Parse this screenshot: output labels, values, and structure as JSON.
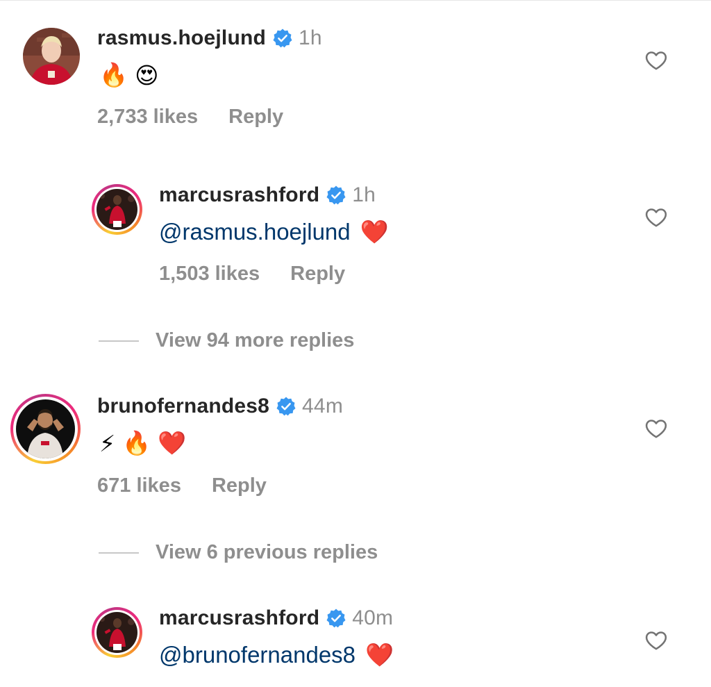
{
  "comments": [
    {
      "username": "rasmus.hoejlund",
      "time": "1h",
      "emojis": [
        "🔥",
        "😍"
      ],
      "likes": "2,733 likes",
      "reply_label": "Reply"
    },
    {
      "username": "marcusrashford",
      "time": "1h",
      "mention": "@rasmus.hoejlund",
      "emojis": [
        "❤️"
      ],
      "likes": "1,503 likes",
      "reply_label": "Reply"
    },
    {
      "username": "brunofernandes8",
      "time": "44m",
      "emojis": [
        "⚡",
        "🔥",
        "❤️"
      ],
      "likes": "671 likes",
      "reply_label": "Reply"
    },
    {
      "username": "marcusrashford",
      "time": "40m",
      "mention": "@brunofernandes8",
      "emojis": [
        "❤️"
      ]
    }
  ],
  "view_more_replies": "View 94 more replies",
  "view_previous_replies": "View 6 previous replies",
  "icons": {
    "verified": "verified-badge-icon",
    "like": "heart-outline-icon"
  },
  "colors": {
    "verified_blue": "#3897f0",
    "mention_blue": "#00376b",
    "secondary_gray": "#8e8e8e"
  }
}
